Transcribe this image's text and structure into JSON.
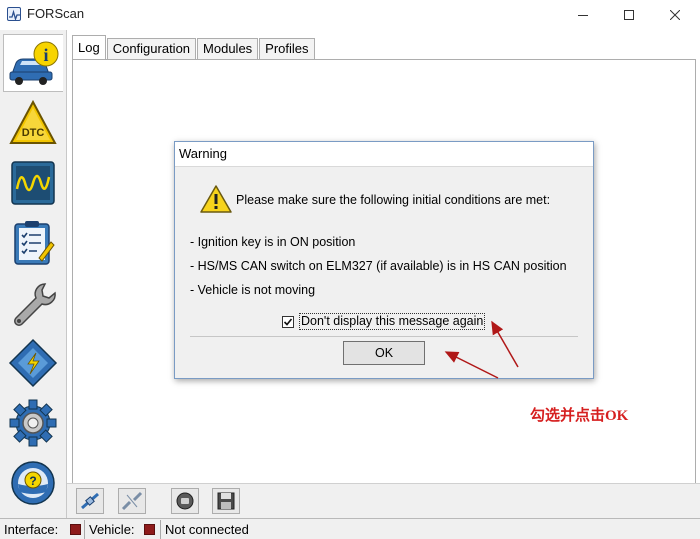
{
  "window": {
    "title": "FORScan"
  },
  "tabs": [
    {
      "label": "Log",
      "active": true
    },
    {
      "label": "Configuration",
      "active": false
    },
    {
      "label": "Modules",
      "active": false
    },
    {
      "label": "Profiles",
      "active": false
    }
  ],
  "left_toolbar": [
    {
      "icon": "car-info-icon",
      "active": true
    },
    {
      "icon": "dtc-icon"
    },
    {
      "icon": "oscilloscope-icon"
    },
    {
      "icon": "checklist-icon"
    },
    {
      "icon": "wrench-icon"
    },
    {
      "icon": "chip-icon"
    },
    {
      "icon": "gear-icon"
    },
    {
      "icon": "steering-wheel-help-icon"
    }
  ],
  "bottom_toolbar": [
    {
      "icon": "connect-icon"
    },
    {
      "icon": "disconnect-icon"
    },
    {
      "icon": "record-icon"
    },
    {
      "icon": "save-icon"
    }
  ],
  "status": {
    "interface_label": "Interface:",
    "vehicle_label": "Vehicle:",
    "connection": "Not connected",
    "indicator_color": "#8e1b1b"
  },
  "dialog": {
    "title": "Warning",
    "heading": "Please make sure the following initial conditions are met:",
    "lines": [
      "- Ignition key is in ON position",
      "- HS/MS CAN switch on ELM327 (if available) is in HS CAN position",
      "- Vehicle is not moving"
    ],
    "checkbox_label": "Don't display this message again",
    "checkbox_checked": true,
    "ok_label": "OK"
  },
  "annotation": {
    "text": "勾选并点击OK",
    "color": "#d62020"
  }
}
